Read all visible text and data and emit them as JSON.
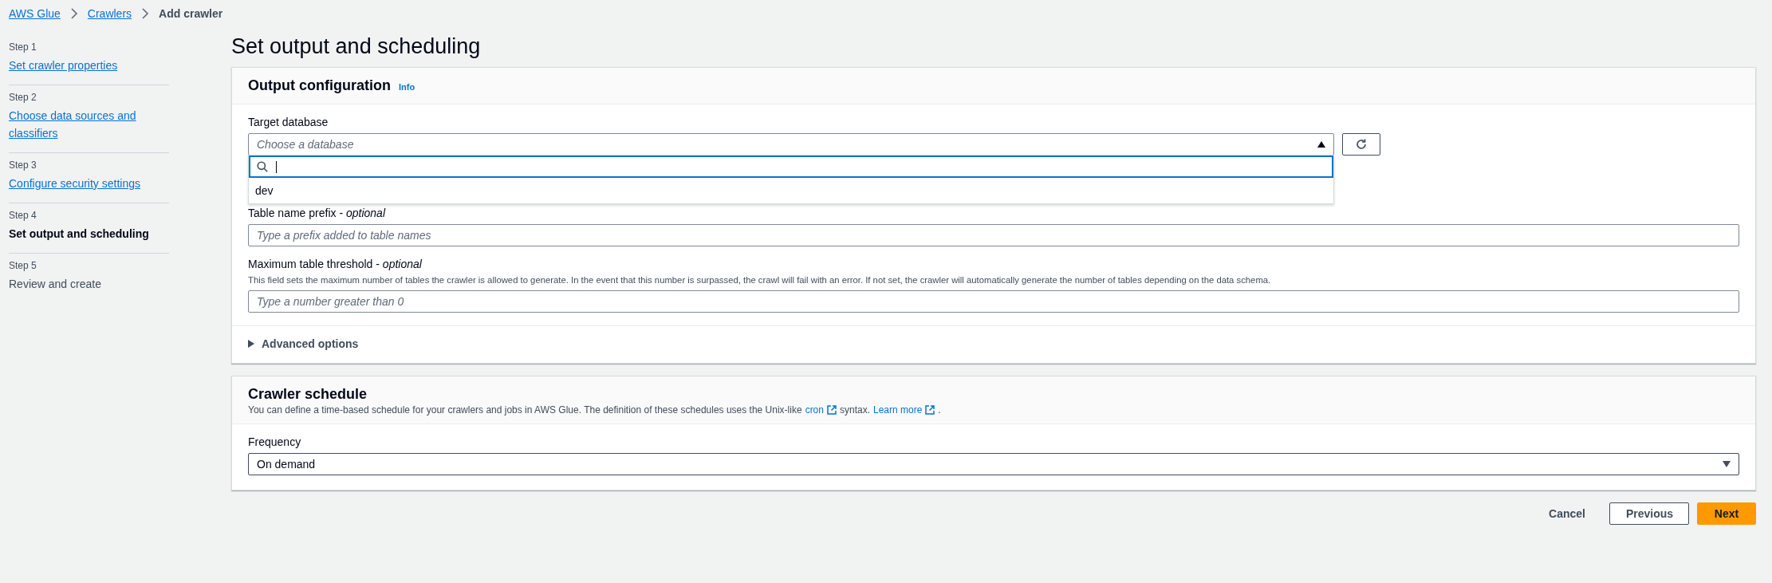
{
  "breadcrumbs": [
    {
      "label": "AWS Glue",
      "link": true
    },
    {
      "label": "Crawlers",
      "link": true
    },
    {
      "label": "Add crawler",
      "link": false
    }
  ],
  "steps": [
    {
      "step": "Step 1",
      "label": "Set crawler properties",
      "selected": false,
      "kind": "link"
    },
    {
      "step": "Step 2",
      "label": "Choose data sources and classifiers",
      "selected": false,
      "kind": "link"
    },
    {
      "step": "Step 3",
      "label": "Configure security settings",
      "selected": false,
      "kind": "link"
    },
    {
      "step": "Step 4",
      "label": "Set output and scheduling",
      "selected": true,
      "kind": "text"
    },
    {
      "step": "Step 5",
      "label": "Review and create",
      "selected": false,
      "kind": "text"
    }
  ],
  "page_title": "Set output and scheduling",
  "output_configuration": {
    "title": "Output configuration",
    "info": "Info",
    "target_database": {
      "label": "Target database",
      "placeholder": "Choose a database",
      "expanded": true,
      "options": [
        "dev"
      ]
    },
    "table_name_prefix": {
      "label": "Table name prefix - *optional*",
      "placeholder": "Type a prefix added to table names"
    },
    "maximum_table_threshold": {
      "label": "Maximum table threshold - *optional*",
      "description": "This field sets the maximum number of tables the crawler is allowed to generate. In the event that this number is surpassed, the crawl will fail with an error. If not set, the crawler will automatically generate the number of tables depending on the data schema.",
      "placeholder": "Type a number greater than 0"
    },
    "advanced_options": {
      "label": "Advanced options",
      "expanded": false
    }
  },
  "crawler_schedule": {
    "title": "Crawler schedule",
    "description_before": "You can define a time-based schedule for your crawlers and jobs in AWS Glue. The definition of these schedules uses the Unix-like",
    "cron_link": "cron",
    "description_middle": "syntax.",
    "learn_more": "Learn more",
    "description_end": ".",
    "frequency": {
      "label": "Frequency",
      "value": "On demand"
    }
  },
  "buttons": {
    "cancel": "Cancel",
    "previous": "Previous",
    "next": "Next"
  }
}
